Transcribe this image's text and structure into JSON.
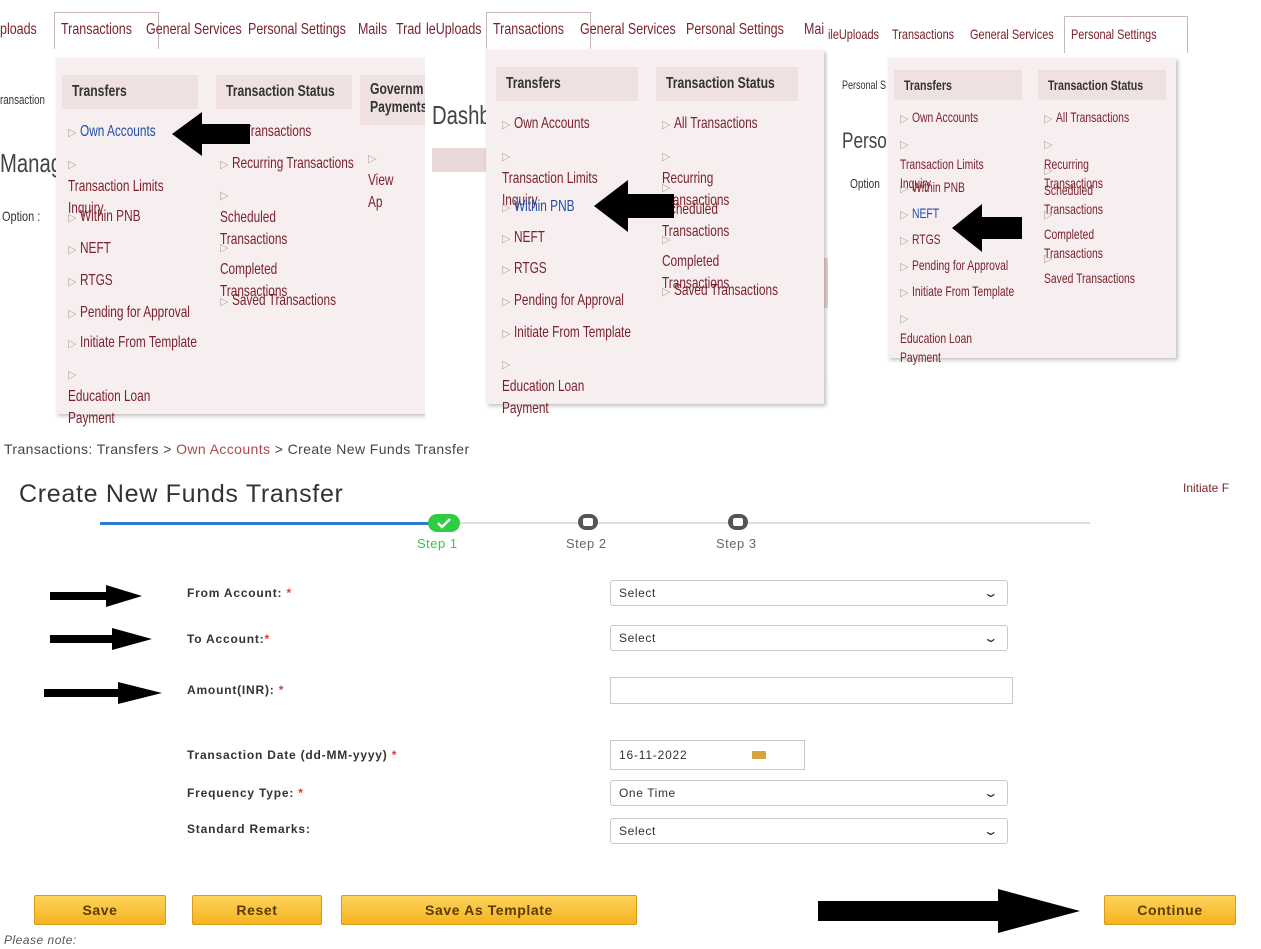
{
  "colors": {
    "menu_text": "#7a1f2b",
    "menu_bg": "#f7efef",
    "header_bg": "#efe1e1",
    "highlight": "#1f4ea8",
    "step_done": "#2ecc40",
    "button": "#f5b31f",
    "track_active": "#2e7bd6"
  },
  "panel1": {
    "tabs": [
      "ploads",
      "Transactions",
      "General Services",
      "Personal Settings",
      "Mails",
      "Trad"
    ],
    "side_texts": [
      "ransaction",
      "Manag",
      "Option :"
    ],
    "col1": {
      "header": "Transfers",
      "items": [
        "Own Accounts",
        "Transaction Limits Inquiry",
        "Within PNB",
        "NEFT",
        "RTGS",
        "Pending for Approval",
        "Initiate From Template",
        "Education Loan Payment"
      ]
    },
    "col2": {
      "header": "Transaction Status",
      "items": [
        "Transactions",
        "Recurring Transactions",
        "Scheduled Transactions",
        "Completed Transactions",
        "Saved Transactions"
      ]
    },
    "col3": {
      "header": "Governm Payments",
      "items": [
        "View Ap"
      ]
    }
  },
  "panel2": {
    "tabs": [
      "leUploads",
      "Transactions",
      "General Services",
      "Personal Settings",
      "Mai"
    ],
    "side_texts": [
      "Dashb"
    ],
    "col1": {
      "header": "Transfers",
      "items": [
        "Own Accounts",
        "Transaction Limits Inquiry",
        "Within PNB",
        "NEFT",
        "RTGS",
        "Pending for Approval",
        "Initiate From Template",
        "Education Loan Payment"
      ]
    },
    "col2": {
      "header": "Transaction Status",
      "items": [
        "All Transactions",
        "Recurring Transactions",
        "Scheduled Transactions",
        "Completed Transactions",
        "Saved Transactions"
      ]
    }
  },
  "panel3": {
    "tabs": [
      "ileUploads",
      "Transactions",
      "General Services",
      "Personal Settings"
    ],
    "side_texts": [
      "Personal S",
      "Persor",
      "Option"
    ],
    "col1": {
      "header": "Transfers",
      "items": [
        "Own Accounts",
        "Transaction Limits Inquiry",
        "Within PNB",
        "NEFT",
        "RTGS",
        "Pending for Approval",
        "Initiate From Template",
        "Education Loan Payment"
      ]
    },
    "col2": {
      "header": "Transaction Status",
      "items": [
        "All Transactions",
        "Recurring Transactions",
        "Scheduled Transactions",
        "Completed Transactions",
        "Saved Transactions"
      ]
    }
  },
  "form": {
    "breadcrumb": {
      "part1": "Transactions: Transfers >",
      "link": "Own Accounts",
      "part2": "> Create New Funds Transfer"
    },
    "title": "Create New Funds Transfer",
    "right_link": "Initiate F",
    "steps": [
      "Step 1",
      "Step 2",
      "Step 3"
    ],
    "step_done_index": 1,
    "fields": {
      "from_label": "From Account:",
      "from_value": "Select",
      "to_label": "To Account:",
      "to_value": "Select",
      "amount_label": "Amount(INR):",
      "amount_value": "",
      "date_label": "Transaction Date (dd-MM-yyyy)",
      "date_value": "16-11-2022",
      "freq_label": "Frequency Type:",
      "freq_value": "One Time",
      "remarks_label": "Standard Remarks:",
      "remarks_value": "Select"
    },
    "required_mark": "*",
    "buttons": {
      "save": "Save",
      "reset": "Reset",
      "template": "Save As Template",
      "continue": "Continue"
    },
    "note": "Please note:"
  }
}
